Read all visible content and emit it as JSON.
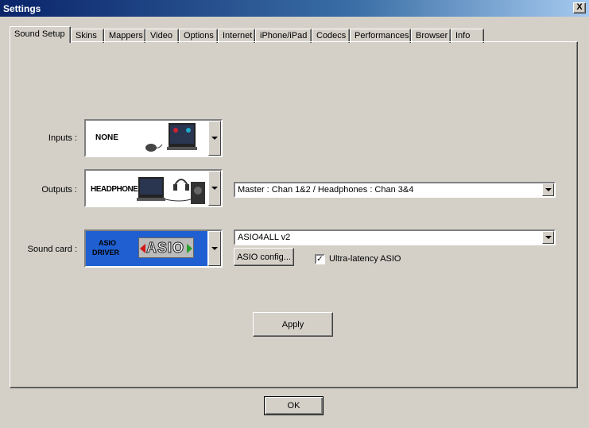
{
  "window": {
    "title": "Settings",
    "close_label": "X"
  },
  "tabs": [
    {
      "label": "Sound Setup",
      "active": true
    },
    {
      "label": "Skins"
    },
    {
      "label": "Mappers"
    },
    {
      "label": "Video"
    },
    {
      "label": "Options"
    },
    {
      "label": "Internet"
    },
    {
      "label": "iPhone/iPad"
    },
    {
      "label": "Codecs"
    },
    {
      "label": "Performances"
    },
    {
      "label": "Browser"
    },
    {
      "label": "Info"
    }
  ],
  "inputs": {
    "label": "Inputs :",
    "value": "NONE"
  },
  "outputs": {
    "label": "Outputs :",
    "value": "HEADPHONES",
    "routing": "Master : Chan 1&2 / Headphones : Chan 3&4"
  },
  "soundcard": {
    "label": "Sound card :",
    "value_line1": "ASIO",
    "value_line2": "DRIVER",
    "logo_text": "ASIO",
    "device": "ASIO4ALL v2",
    "config_button": "ASIO config...",
    "ultra_latency_label": "Ultra-latency ASIO",
    "ultra_latency_checked": true
  },
  "apply_label": "Apply",
  "ok_label": "OK",
  "colors": {
    "title_active": "#0a246a",
    "asio_blue": "#1f5fd1",
    "asio_green": "#2aa02a",
    "asio_red": "#d01818"
  }
}
